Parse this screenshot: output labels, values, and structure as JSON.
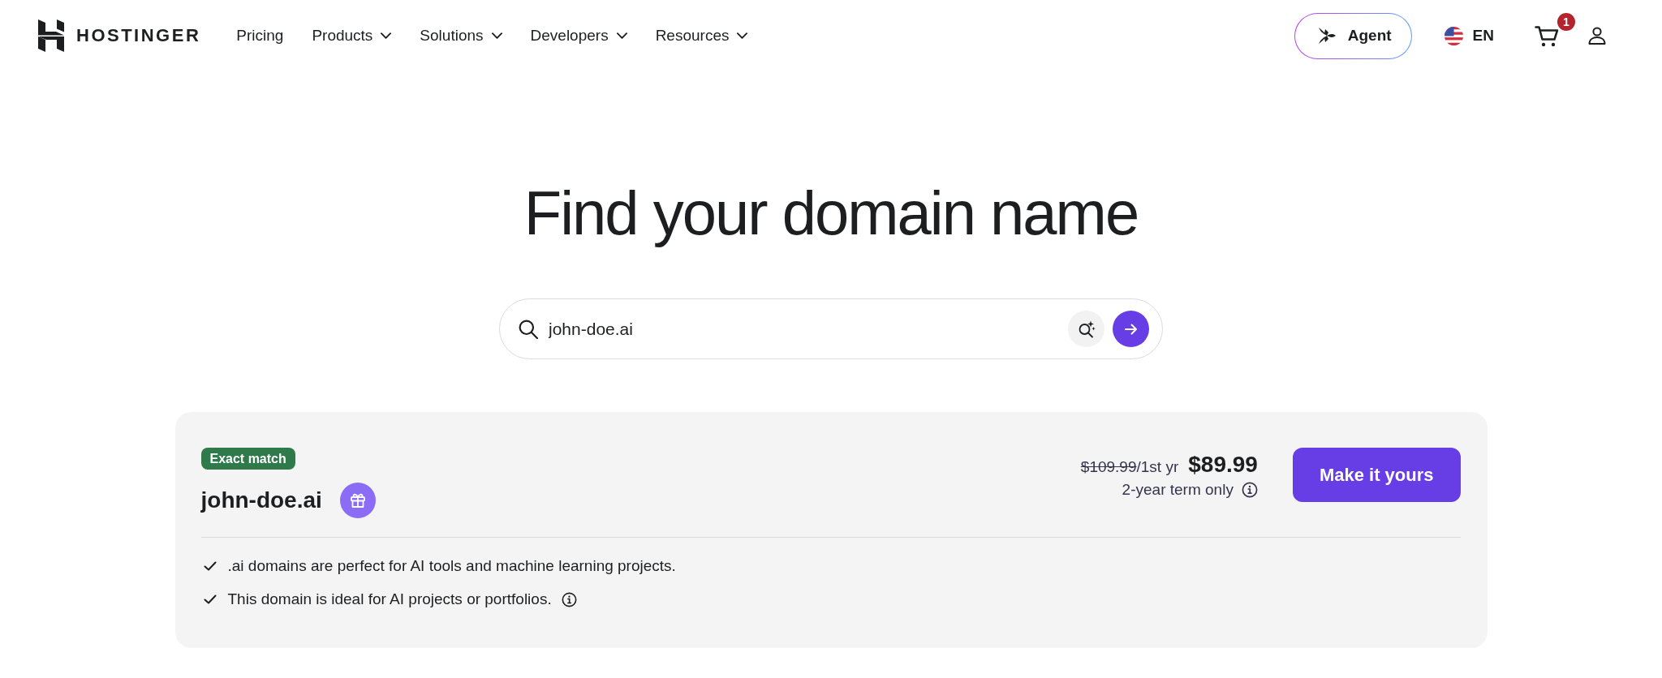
{
  "header": {
    "logo": "HOSTINGER",
    "nav": [
      {
        "label": "Pricing",
        "has_menu": false
      },
      {
        "label": "Products",
        "has_menu": true
      },
      {
        "label": "Solutions",
        "has_menu": true
      },
      {
        "label": "Developers",
        "has_menu": true
      },
      {
        "label": "Resources",
        "has_menu": true
      }
    ],
    "agent_button": "Agent",
    "language": "EN",
    "cart_count": "1"
  },
  "hero": {
    "title": "Find your domain name"
  },
  "search": {
    "value": "john-doe.ai"
  },
  "result": {
    "badge": "Exact match",
    "domain": "john-doe.ai",
    "old_price": "$109.99",
    "period": "/1st yr",
    "price": "$89.99",
    "term": "2-year term only",
    "button": "Make it yours",
    "features": [
      {
        "text": ".ai domains are perfect for AI tools and machine learning projects.",
        "info": false
      },
      {
        "text": "This domain is ideal for AI projects or portfolios.",
        "info": true
      }
    ]
  }
}
